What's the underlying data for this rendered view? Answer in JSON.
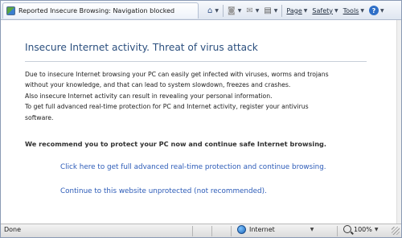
{
  "window": {
    "tab_title": "Reported Insecure Browsing: Navigation blocked"
  },
  "toolbar": {
    "page_label": "Page",
    "safety_label": "Safety",
    "tools_label": "Tools"
  },
  "page": {
    "heading": "Insecure Internet activity. Threat of virus attack",
    "paragraphs": [
      "Due to insecure Internet browsing your PC can easily get infected with viruses, worms and trojans",
      "without your knowledge, and that can lead to system slowdown, freezes and crashes.",
      "Also insecure Internet activity can result in revealing your personal information.",
      "To get full advanced real-time protection for PC and Internet activity, register your antivirus",
      "software."
    ],
    "recommendation": "We recommend you to protect your PC now and continue safe Internet browsing.",
    "link_protect": "Click here to get full advanced real-time protection and continue browsing.",
    "link_continue": "Continue to this website unprotected (not recommended)."
  },
  "statusbar": {
    "status": "Done",
    "zone": "Internet",
    "zoom": "100%"
  },
  "colors": {
    "heading": "#2b4f7e",
    "link": "#2c5bb8",
    "chrome": "#dfe6f1"
  },
  "icons": [
    "favicon-icon",
    "home-icon",
    "rss-icon",
    "mail-icon",
    "print-icon",
    "help-icon",
    "globe-icon",
    "magnifier-icon"
  ]
}
